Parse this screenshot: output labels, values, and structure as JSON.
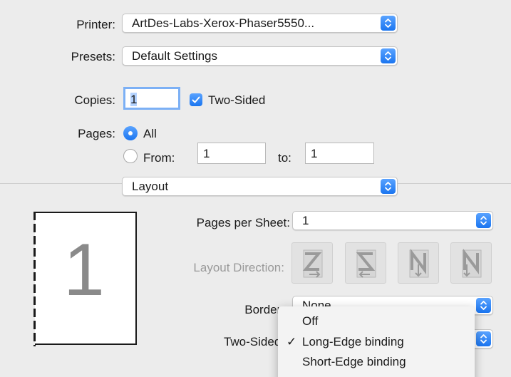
{
  "printer": {
    "label": "Printer:",
    "value": "ArtDes-Labs-Xerox-Phaser5550..."
  },
  "presets": {
    "label": "Presets:",
    "value": "Default Settings"
  },
  "copies": {
    "label": "Copies:",
    "value": "1",
    "two_sided_label": "Two-Sided",
    "two_sided_checked": true
  },
  "pages": {
    "label": "Pages:",
    "all_label": "All",
    "from_label": "From:",
    "from_value": "1",
    "to_label": "to:",
    "to_value": "1",
    "selected": "all"
  },
  "section": {
    "value": "Layout"
  },
  "preview": {
    "page_number": "1"
  },
  "layout": {
    "pages_per_sheet_label": "Pages per Sheet:",
    "pages_per_sheet_value": "1",
    "direction_label": "Layout Direction:",
    "border_label": "Border:",
    "border_value": "None",
    "two_sided_label": "Two-Sided:"
  },
  "two_sided_menu": {
    "items": [
      "Off",
      "Long-Edge binding",
      "Short-Edge binding"
    ],
    "checked_index": 1,
    "check_mark": "✓"
  },
  "colors": {
    "accent": "#1a75f0",
    "background": "#ececec"
  }
}
